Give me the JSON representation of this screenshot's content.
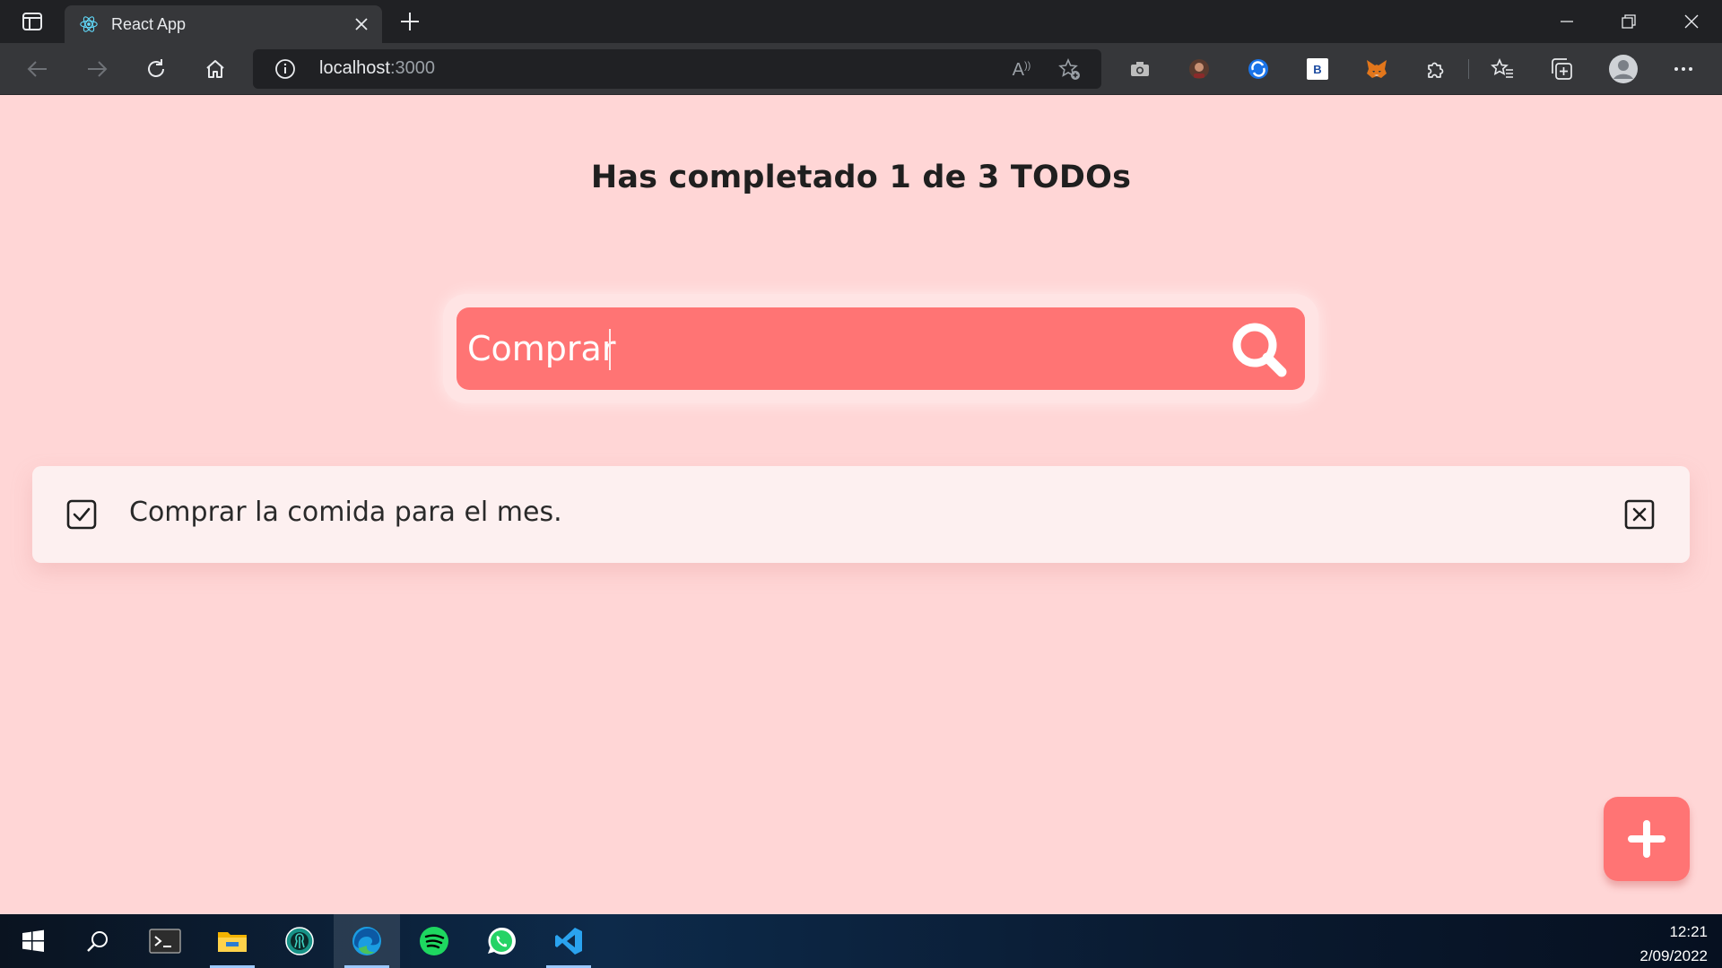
{
  "browser": {
    "tab_title": "React App",
    "url_host": "localhost",
    "url_port": ":3000"
  },
  "page": {
    "counter_text": "Has completado 1 de 3 TODOs",
    "search": {
      "value": "Comprar",
      "placeholder": ""
    },
    "todos": [
      {
        "text": "Comprar la comida para el mes.",
        "completed": true
      }
    ]
  },
  "colors": {
    "page_background": "#ffd6d6",
    "accent": "#ff7474",
    "todo_background": "#fdf0f0"
  },
  "taskbar": {
    "time": "12:21",
    "date": "2/09/2022"
  }
}
